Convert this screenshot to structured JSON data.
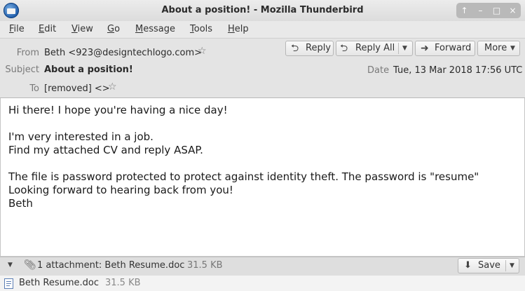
{
  "window": {
    "title": "About a position! - Mozilla Thunderbird",
    "controls": [
      "↑",
      "–",
      "□",
      "×"
    ]
  },
  "menu": [
    "File",
    "Edit",
    "View",
    "Go",
    "Message",
    "Tools",
    "Help"
  ],
  "header": {
    "from_label": "From",
    "from_value": "Beth <923@designtechlogo.com>",
    "subject_label": "Subject",
    "subject_value": "About a position!",
    "to_label": "To",
    "to_value": "[removed] <>",
    "date_label": "Date",
    "date_value": "Tue, 13 Mar 2018 17:56 UTC"
  },
  "toolbar": {
    "reply": "Reply",
    "reply_all": "Reply All",
    "forward": "Forward",
    "more": "More"
  },
  "body_lines": [
    "Hi there! I hope you're having a nice day!",
    "I'm very interested in a job.",
    "Find my attached CV and reply ASAP.",
    "The file is password protected to protect against identity theft. The password is \"resume\"",
    "Looking forward to hearing back from you!",
    "Beth"
  ],
  "attachment_bar": {
    "summary": "1 attachment: Beth Resume.doc",
    "size": "31.5 KB",
    "save": "Save"
  },
  "attachment_item": {
    "name": "Beth Resume.doc",
    "size": "31.5 KB"
  }
}
